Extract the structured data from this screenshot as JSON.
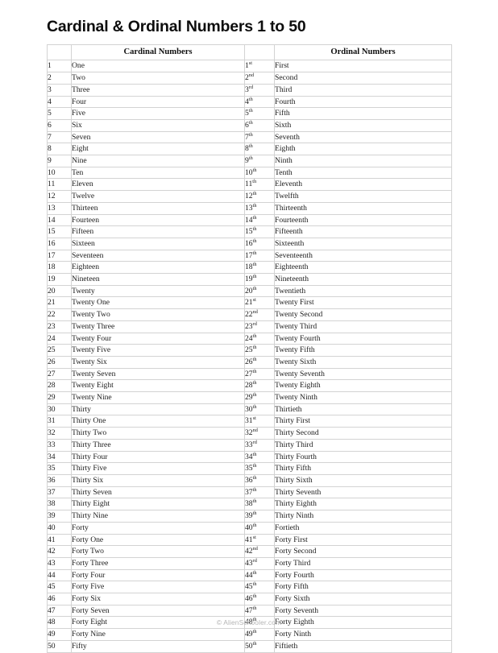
{
  "document": {
    "title": "Cardinal & Ordinal Numbers 1 to 50",
    "footer": "© AlienSchooler.com"
  },
  "table": {
    "headers": {
      "blank_left": "",
      "cardinal": "Cardinal Numbers",
      "blank_right": "",
      "ordinal": "Ordinal Numbers"
    },
    "rows": [
      {
        "num": "1",
        "word": "One",
        "onum": "1",
        "suffix": "st",
        "oword": "First"
      },
      {
        "num": "2",
        "word": "Two",
        "onum": "2",
        "suffix": "nd",
        "oword": "Second"
      },
      {
        "num": "3",
        "word": "Three",
        "onum": "3",
        "suffix": "rd",
        "oword": "Third"
      },
      {
        "num": "4",
        "word": "Four",
        "onum": "4",
        "suffix": "th",
        "oword": "Fourth"
      },
      {
        "num": "5",
        "word": "Five",
        "onum": "5",
        "suffix": "th",
        "oword": "Fifth"
      },
      {
        "num": "6",
        "word": "Six",
        "onum": "6",
        "suffix": "th",
        "oword": "Sixth"
      },
      {
        "num": "7",
        "word": "Seven",
        "onum": "7",
        "suffix": "th",
        "oword": "Seventh"
      },
      {
        "num": "8",
        "word": "Eight",
        "onum": "8",
        "suffix": "th",
        "oword": "Eighth"
      },
      {
        "num": "9",
        "word": "Nine",
        "onum": "9",
        "suffix": "th",
        "oword": "Ninth"
      },
      {
        "num": "10",
        "word": "Ten",
        "onum": "10",
        "suffix": "th",
        "oword": "Tenth"
      },
      {
        "num": "11",
        "word": "Eleven",
        "onum": "11",
        "suffix": "th",
        "oword": "Eleventh"
      },
      {
        "num": "12",
        "word": "Twelve",
        "onum": "12",
        "suffix": "th",
        "oword": "Twelfth"
      },
      {
        "num": "13",
        "word": "Thirteen",
        "onum": "13",
        "suffix": "th",
        "oword": "Thirteenth"
      },
      {
        "num": "14",
        "word": "Fourteen",
        "onum": "14",
        "suffix": "th",
        "oword": "Fourteenth"
      },
      {
        "num": "15",
        "word": "Fifteen",
        "onum": "15",
        "suffix": "th",
        "oword": "Fifteenth"
      },
      {
        "num": "16",
        "word": "Sixteen",
        "onum": "16",
        "suffix": "th",
        "oword": "Sixteenth"
      },
      {
        "num": "17",
        "word": "Seventeen",
        "onum": "17",
        "suffix": "th",
        "oword": "Seventeenth"
      },
      {
        "num": "18",
        "word": "Eighteen",
        "onum": "18",
        "suffix": "th",
        "oword": "Eighteenth"
      },
      {
        "num": "19",
        "word": "Nineteen",
        "onum": "19",
        "suffix": "th",
        "oword": "Nineteenth"
      },
      {
        "num": "20",
        "word": "Twenty",
        "onum": "20",
        "suffix": "th",
        "oword": "Twentieth"
      },
      {
        "num": "21",
        "word": "Twenty One",
        "onum": "21",
        "suffix": "st",
        "oword": "Twenty First"
      },
      {
        "num": "22",
        "word": "Twenty Two",
        "onum": "22",
        "suffix": "nd",
        "oword": "Twenty Second"
      },
      {
        "num": "23",
        "word": "Twenty Three",
        "onum": "23",
        "suffix": "rd",
        "oword": "Twenty Third"
      },
      {
        "num": "24",
        "word": "Twenty Four",
        "onum": "24",
        "suffix": "th",
        "oword": "Twenty Fourth"
      },
      {
        "num": "25",
        "word": "Twenty Five",
        "onum": "25",
        "suffix": "th",
        "oword": "Twenty Fifth"
      },
      {
        "num": "26",
        "word": "Twenty Six",
        "onum": "26",
        "suffix": "th",
        "oword": "Twenty Sixth"
      },
      {
        "num": "27",
        "word": "Twenty Seven",
        "onum": "27",
        "suffix": "th",
        "oword": "Twenty Seventh"
      },
      {
        "num": "28",
        "word": "Twenty Eight",
        "onum": "28",
        "suffix": "th",
        "oword": "Twenty Eighth"
      },
      {
        "num": "29",
        "word": "Twenty Nine",
        "onum": "29",
        "suffix": "th",
        "oword": "Twenty Ninth"
      },
      {
        "num": "30",
        "word": "Thirty",
        "onum": "30",
        "suffix": "th",
        "oword": "Thirtieth"
      },
      {
        "num": "31",
        "word": "Thirty One",
        "onum": "31",
        "suffix": "st",
        "oword": "Thirty First"
      },
      {
        "num": "32",
        "word": "Thirty Two",
        "onum": "32",
        "suffix": "nd",
        "oword": "Thirty Second"
      },
      {
        "num": "33",
        "word": "Thirty Three",
        "onum": "33",
        "suffix": "rd",
        "oword": "Thirty Third"
      },
      {
        "num": "34",
        "word": "Thirty Four",
        "onum": "34",
        "suffix": "th",
        "oword": "Thirty Fourth"
      },
      {
        "num": "35",
        "word": "Thirty Five",
        "onum": "35",
        "suffix": "th",
        "oword": "Thirty Fifth"
      },
      {
        "num": "36",
        "word": "Thirty Six",
        "onum": "36",
        "suffix": "th",
        "oword": "Thirty Sixth"
      },
      {
        "num": "37",
        "word": "Thirty Seven",
        "onum": "37",
        "suffix": "th",
        "oword": "Thirty Seventh"
      },
      {
        "num": "38",
        "word": "Thirty Eight",
        "onum": "38",
        "suffix": "th",
        "oword": "Thirty Eighth"
      },
      {
        "num": "39",
        "word": "Thirty Nine",
        "onum": "39",
        "suffix": "th",
        "oword": "Thirty Ninth"
      },
      {
        "num": "40",
        "word": "Forty",
        "onum": "40",
        "suffix": "th",
        "oword": "Fortieth"
      },
      {
        "num": "41",
        "word": "Forty One",
        "onum": "41",
        "suffix": "st",
        "oword": "Forty First"
      },
      {
        "num": "42",
        "word": "Forty Two",
        "onum": "42",
        "suffix": "nd",
        "oword": "Forty Second"
      },
      {
        "num": "43",
        "word": "Forty Three",
        "onum": "43",
        "suffix": "rd",
        "oword": "Forty Third"
      },
      {
        "num": "44",
        "word": "Forty Four",
        "onum": "44",
        "suffix": "th",
        "oword": "Forty Fourth"
      },
      {
        "num": "45",
        "word": "Forty Five",
        "onum": "45",
        "suffix": "th",
        "oword": "Forty Fifth"
      },
      {
        "num": "46",
        "word": "Forty Six",
        "onum": "46",
        "suffix": "th",
        "oword": "Forty Sixth"
      },
      {
        "num": "47",
        "word": "Forty Seven",
        "onum": "47",
        "suffix": "th",
        "oword": "Forty Seventh"
      },
      {
        "num": "48",
        "word": "Forty Eight",
        "onum": "48",
        "suffix": "th",
        "oword": "Forty Eighth"
      },
      {
        "num": "49",
        "word": "Forty Nine",
        "onum": "49",
        "suffix": "th",
        "oword": "Forty Ninth"
      },
      {
        "num": "50",
        "word": "Fifty",
        "onum": "50",
        "suffix": "th",
        "oword": "Fiftieth"
      }
    ]
  }
}
